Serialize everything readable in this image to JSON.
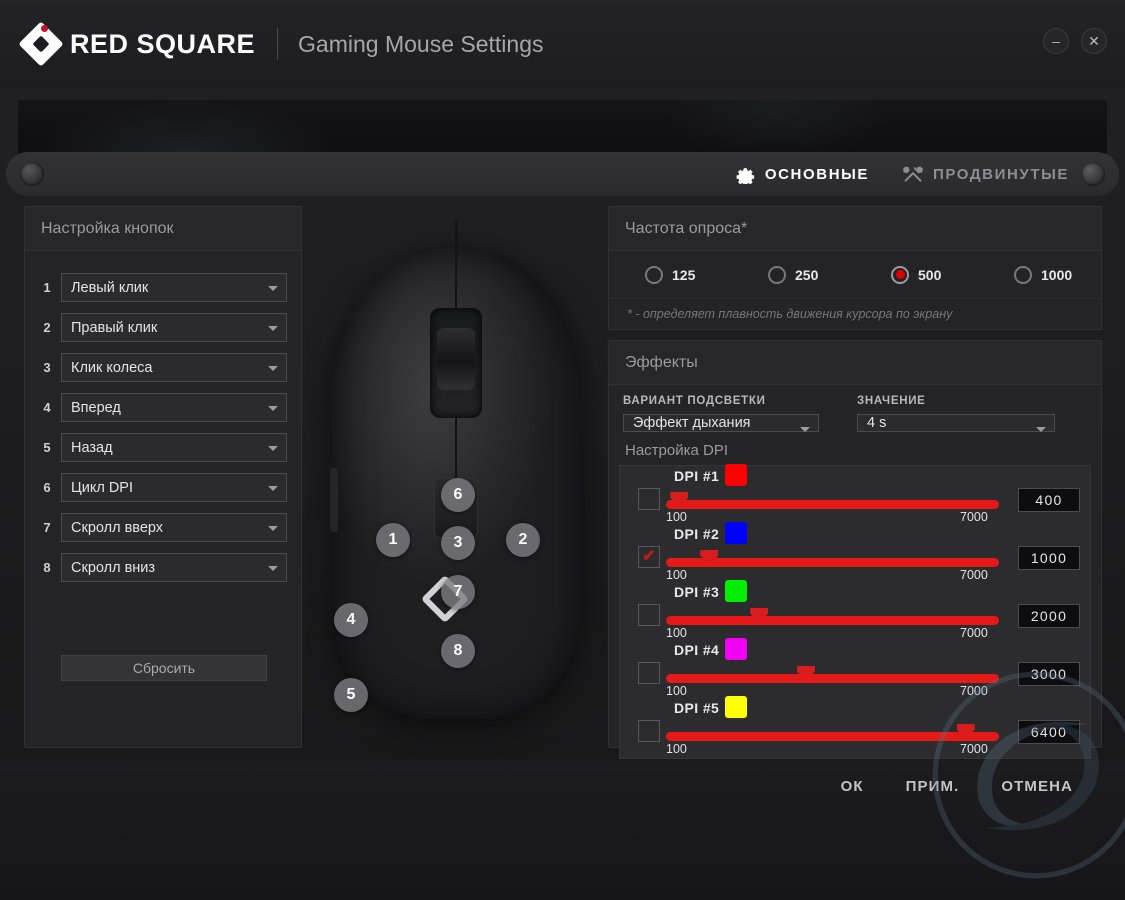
{
  "titlebar": {
    "brand": "RED SQUARE",
    "subtitle": "Gaming Mouse Settings",
    "minimize": "–",
    "close": "✕"
  },
  "tabs": [
    {
      "label": "ОСНОВНЫЕ",
      "icon": "gear-icon",
      "active": true
    },
    {
      "label": "ПРОДВИНУТЫЕ",
      "icon": "tools-icon",
      "active": false
    }
  ],
  "buttons_panel": {
    "title": "Настройка кнопок",
    "reset_label": "Сбросить",
    "rows": [
      {
        "num": "1",
        "value": "Левый клик"
      },
      {
        "num": "2",
        "value": "Правый клик"
      },
      {
        "num": "3",
        "value": "Клик колеса"
      },
      {
        "num": "4",
        "value": "Вперед"
      },
      {
        "num": "5",
        "value": "Назад"
      },
      {
        "num": "6",
        "value": "Цикл DPI"
      },
      {
        "num": "7",
        "value": "Скролл вверх"
      },
      {
        "num": "8",
        "value": "Скролл вниз"
      }
    ]
  },
  "mouse_callouts": [
    {
      "num": "1"
    },
    {
      "num": "2"
    },
    {
      "num": "3"
    },
    {
      "num": "4"
    },
    {
      "num": "5"
    },
    {
      "num": "6"
    },
    {
      "num": "7"
    },
    {
      "num": "8"
    }
  ],
  "polling": {
    "title": "Частота опроса*",
    "note": "* - определяет плавность движения курсора по экрану",
    "options": [
      {
        "label": "125",
        "selected": false
      },
      {
        "label": "250",
        "selected": false
      },
      {
        "label": "500",
        "selected": true
      },
      {
        "label": "1000",
        "selected": false
      }
    ]
  },
  "effects": {
    "title": "Эффекты",
    "mode_label": "ВАРИАНТ ПОДСВЕТКИ",
    "mode_value": "Эффект дыхания",
    "value_label": "ЗНАЧЕНИЕ",
    "value_value": "4 s",
    "dpi_title": "Настройка DPI",
    "dpi_min": "100",
    "dpi_max": "7000",
    "dpi_rows": [
      {
        "name": "DPI  #1",
        "color": "#ff0000",
        "value": "400",
        "checked": false,
        "pct": 4
      },
      {
        "name": "DPI  #2",
        "color": "#0000ff",
        "value": "1000",
        "checked": true,
        "pct": 13
      },
      {
        "name": "DPI  #3",
        "color": "#00ee00",
        "value": "2000",
        "checked": false,
        "pct": 28
      },
      {
        "name": "DPI  #4",
        "color": "#f000f0",
        "value": "3000",
        "checked": false,
        "pct": 42
      },
      {
        "name": "DPI  #5",
        "color": "#ffff00",
        "value": "6400",
        "checked": false,
        "pct": 90
      }
    ]
  },
  "footer": {
    "ok": "ОК",
    "apply": "ПРИМ.",
    "cancel": "ОТМЕНА"
  }
}
